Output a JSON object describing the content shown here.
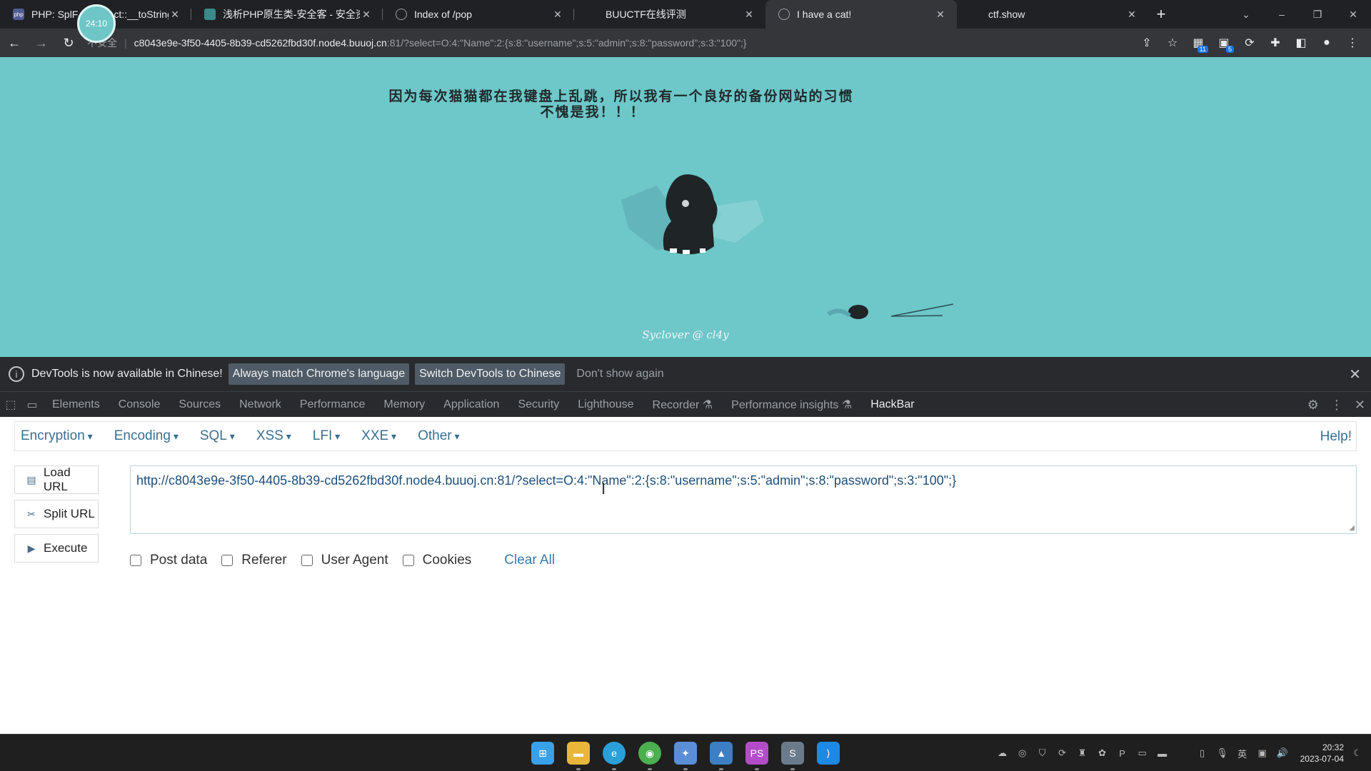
{
  "timer": "24:10",
  "tabs": [
    {
      "title": "PHP: SplF",
      "title_tail": "ct::__toString",
      "favicon_color": "#4f5b93",
      "favicon_text": "php",
      "active": false
    },
    {
      "title": "浅析PHP原生类-安全客 - 安全资",
      "favicon_color": "#3a8a8a",
      "favicon_text": "",
      "active": false
    },
    {
      "title": "Index of /pop",
      "favicon_color": "#5f6368",
      "favicon_text": "",
      "active": false
    },
    {
      "title": "BUUCTF在线评测",
      "favicon_color": "#202124",
      "favicon_text": "",
      "active": false
    },
    {
      "title": "I have a cat!",
      "favicon_color": "#5f6368",
      "favicon_text": "",
      "active": true
    },
    {
      "title": "ctf.show",
      "favicon_color": "#202124",
      "favicon_text": "",
      "active": false
    }
  ],
  "address": {
    "security_label": "不安全",
    "host": "c8043e9e-3f50-4405-8b39-cd5262fbd30f.node4.buuoj.cn",
    "path": ":81/?select=O:4:\"Name\":2:{s:8:\"username\";s:5:\"admin\";s:8:\"password\";s:3:\"100\";}"
  },
  "extensions": [
    {
      "name": "puzzle-ext-icon",
      "badge": "11"
    },
    {
      "name": "screen-ext-icon",
      "badge": "5"
    }
  ],
  "page": {
    "headline_line1": "因为每次猫猫都在我键盘上乱跳，所以我有一个良好的备份网站的习惯",
    "headline_line2": "不愧是我！！！",
    "footer": "Syclover @ cl4y",
    "background": "#6ec7c9"
  },
  "devtools": {
    "info_text": "DevTools is now available in Chinese!",
    "btn_match": "Always match Chrome's language",
    "btn_switch": "Switch DevTools to Chinese",
    "link_dont_show": "Don't show again",
    "tabs": [
      "Elements",
      "Console",
      "Sources",
      "Network",
      "Performance",
      "Memory",
      "Application",
      "Security",
      "Lighthouse",
      "Recorder ⚗",
      "Performance insights ⚗",
      "HackBar"
    ],
    "selected_tab": "HackBar"
  },
  "hackbar": {
    "menus": [
      "Encryption",
      "Encoding",
      "SQL",
      "XSS",
      "LFI",
      "XXE",
      "Other"
    ],
    "help": "Help!",
    "load_url": "Load URL",
    "split_url": "Split URL",
    "execute": "Execute",
    "url_value": "http://c8043e9e-3f50-4405-8b39-cd5262fbd30f.node4.buuoj.cn:81/?select=O:4:\"Name\":2:{s:8:\"username\";s:5:\"admin\";s:8:\"password\";s:3:\"100\";}",
    "options": [
      "Post data",
      "Referer",
      "User Agent",
      "Cookies"
    ],
    "clear_all": "Clear All"
  },
  "taskbar": {
    "apps": [
      {
        "name": "start-icon",
        "color": "#3aa0e8"
      },
      {
        "name": "file-explorer-icon",
        "color": "#e8b73a"
      },
      {
        "name": "edge-icon",
        "color": "#2a9fd8"
      },
      {
        "name": "chrome-icon",
        "color": "#4caf50"
      },
      {
        "name": "app-icon",
        "color": "#5a8fd8"
      },
      {
        "name": "photos-icon",
        "color": "#3c7fc4"
      },
      {
        "name": "phpstorm-icon",
        "color": "#b34cc9"
      },
      {
        "name": "sublime-icon",
        "color": "#6a7b8c"
      },
      {
        "name": "vscode-icon",
        "color": "#1e88e5"
      }
    ],
    "ime": "英",
    "time": "20:32",
    "date": "2023-07-04"
  }
}
